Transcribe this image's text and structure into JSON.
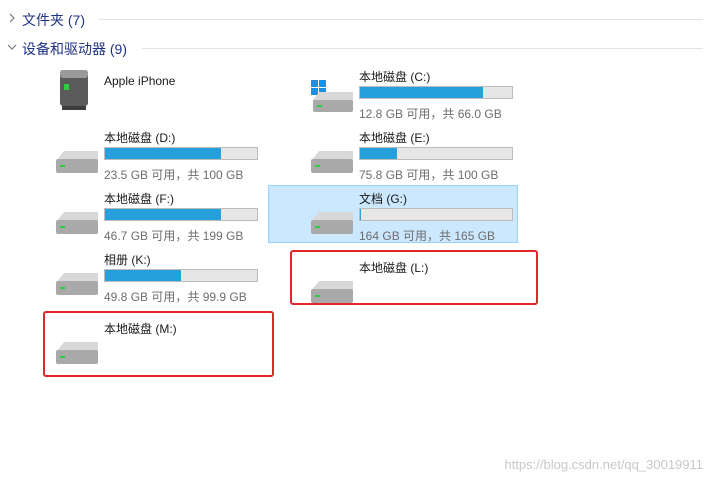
{
  "groups": {
    "folders": {
      "label": "文件夹 (7)",
      "expanded": false
    },
    "devices": {
      "label": "设备和驱动器 (9)",
      "expanded": true
    }
  },
  "devices": [
    {
      "name": "Apple iPhone",
      "icon": "phone-device-icon"
    },
    {
      "name": "本地磁盘 (C:)",
      "free_text": "12.8 GB 可用，共 66.0 GB",
      "used_fraction": 0.806,
      "icon": "windows-drive-icon"
    },
    {
      "name": "本地磁盘 (D:)",
      "free_text": "23.5 GB 可用，共 100 GB",
      "used_fraction": 0.765,
      "icon": "hard-drive-icon"
    },
    {
      "name": "本地磁盘 (E:)",
      "free_text": "75.8 GB 可用，共 100 GB",
      "used_fraction": 0.242,
      "icon": "hard-drive-icon"
    },
    {
      "name": "本地磁盘 (F:)",
      "free_text": "46.7 GB 可用，共 199 GB",
      "used_fraction": 0.765,
      "icon": "hard-drive-icon"
    },
    {
      "name": "文档 (G:)",
      "free_text": "164 GB 可用，共 165 GB",
      "used_fraction": 0.006,
      "icon": "hard-drive-icon",
      "selected": true
    },
    {
      "name": "相册 (K:)",
      "free_text": "49.8 GB 可用，共 99.9 GB",
      "used_fraction": 0.502,
      "icon": "hard-drive-icon"
    },
    {
      "name": "本地磁盘 (L:)",
      "icon": "hard-drive-icon",
      "highlighted": true
    },
    {
      "name": "本地磁盘 (M:)",
      "icon": "hard-drive-icon",
      "highlighted": true
    }
  ],
  "colors": {
    "accent": "#1e3287",
    "bar_fill": "#26a0da",
    "selection": "#cce8ff",
    "highlight_box": "#e0272d"
  },
  "watermark": "https://blog.csdn.net/qq_30019911"
}
